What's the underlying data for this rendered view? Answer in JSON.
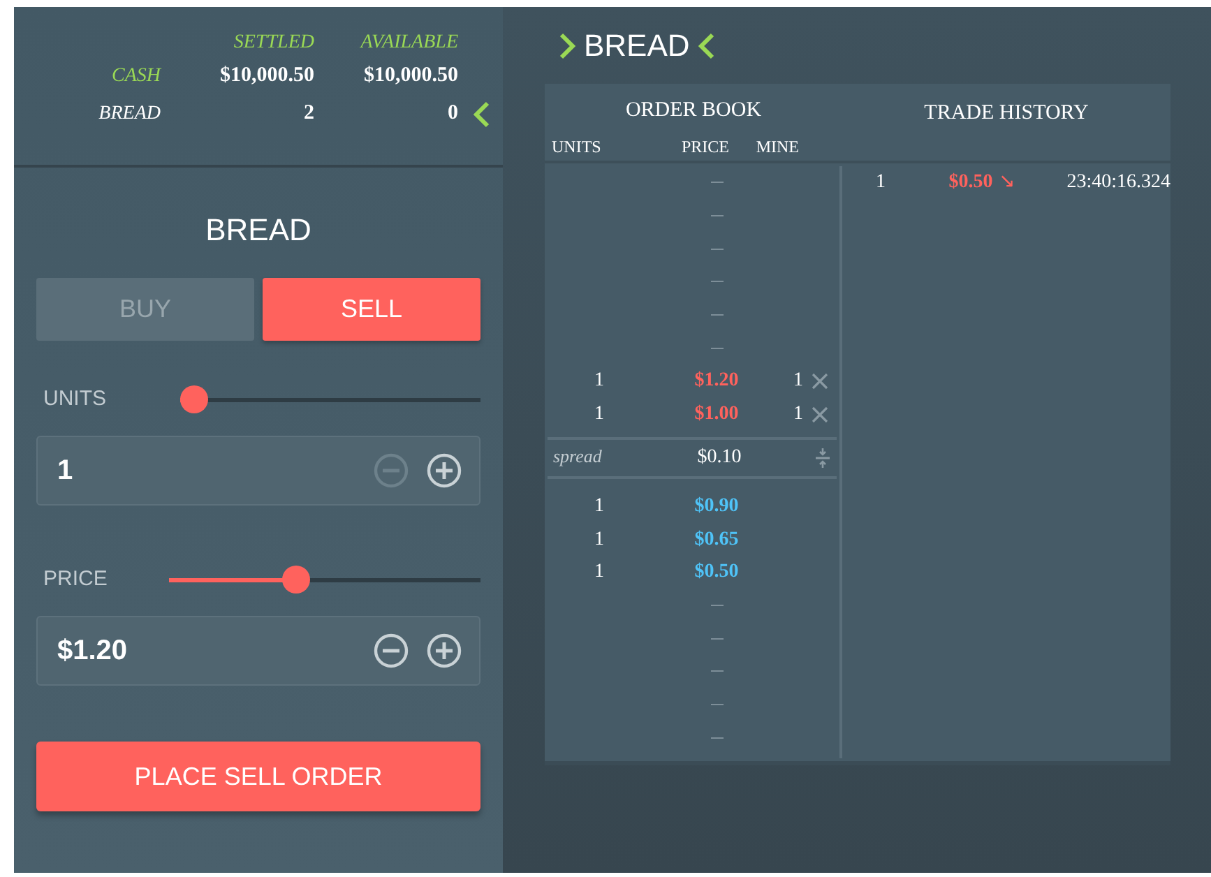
{
  "balances": {
    "columns": [
      "SETTLED",
      "AVAILABLE"
    ],
    "rows": [
      {
        "label": "CASH",
        "kind": "cash",
        "settled": "$10,000.50",
        "available": "$10,000.50",
        "selected": false
      },
      {
        "label": "BREAD",
        "kind": "asset",
        "settled": "2",
        "available": "0",
        "selected": true
      }
    ]
  },
  "order_form": {
    "title": "BREAD",
    "sides": [
      {
        "label": "BUY",
        "selected": false
      },
      {
        "label": "SELL",
        "selected": true
      }
    ],
    "units": {
      "label": "UNITS",
      "level": 0,
      "value": "1",
      "minus_disabled": true,
      "plus_disabled": false
    },
    "price": {
      "label": "PRICE",
      "level": 0.4,
      "value": "$1.20",
      "minus_disabled": false,
      "plus_disabled": false
    },
    "submit": "PLACE SELL ORDER"
  },
  "market": {
    "title": "BREAD",
    "order_book": {
      "title": "ORDER BOOK",
      "columns": [
        "UNITS",
        "PRICE",
        "MINE"
      ],
      "asks": [
        {
          "kind": "empty"
        },
        {
          "kind": "empty"
        },
        {
          "kind": "empty"
        },
        {
          "kind": "empty"
        },
        {
          "kind": "empty"
        },
        {
          "kind": "empty"
        },
        {
          "kind": "order",
          "units": "1",
          "price": "$1.20",
          "mine": "1"
        },
        {
          "kind": "order",
          "units": "1",
          "price": "$1.00",
          "mine": "1"
        }
      ],
      "spread": {
        "label": "spread",
        "value": "$0.10"
      },
      "bids": [
        {
          "kind": "order",
          "units": "1",
          "price": "$0.90"
        },
        {
          "kind": "order",
          "units": "1",
          "price": "$0.65"
        },
        {
          "kind": "order",
          "units": "1",
          "price": "$0.50"
        },
        {
          "kind": "empty"
        },
        {
          "kind": "empty"
        },
        {
          "kind": "empty"
        },
        {
          "kind": "empty"
        },
        {
          "kind": "empty"
        }
      ]
    },
    "trade_history": {
      "title": "TRADE HISTORY",
      "trades": [
        {
          "units": "1",
          "price": "$0.50",
          "direction": "↘",
          "time": "23:40:16.324"
        }
      ]
    }
  }
}
